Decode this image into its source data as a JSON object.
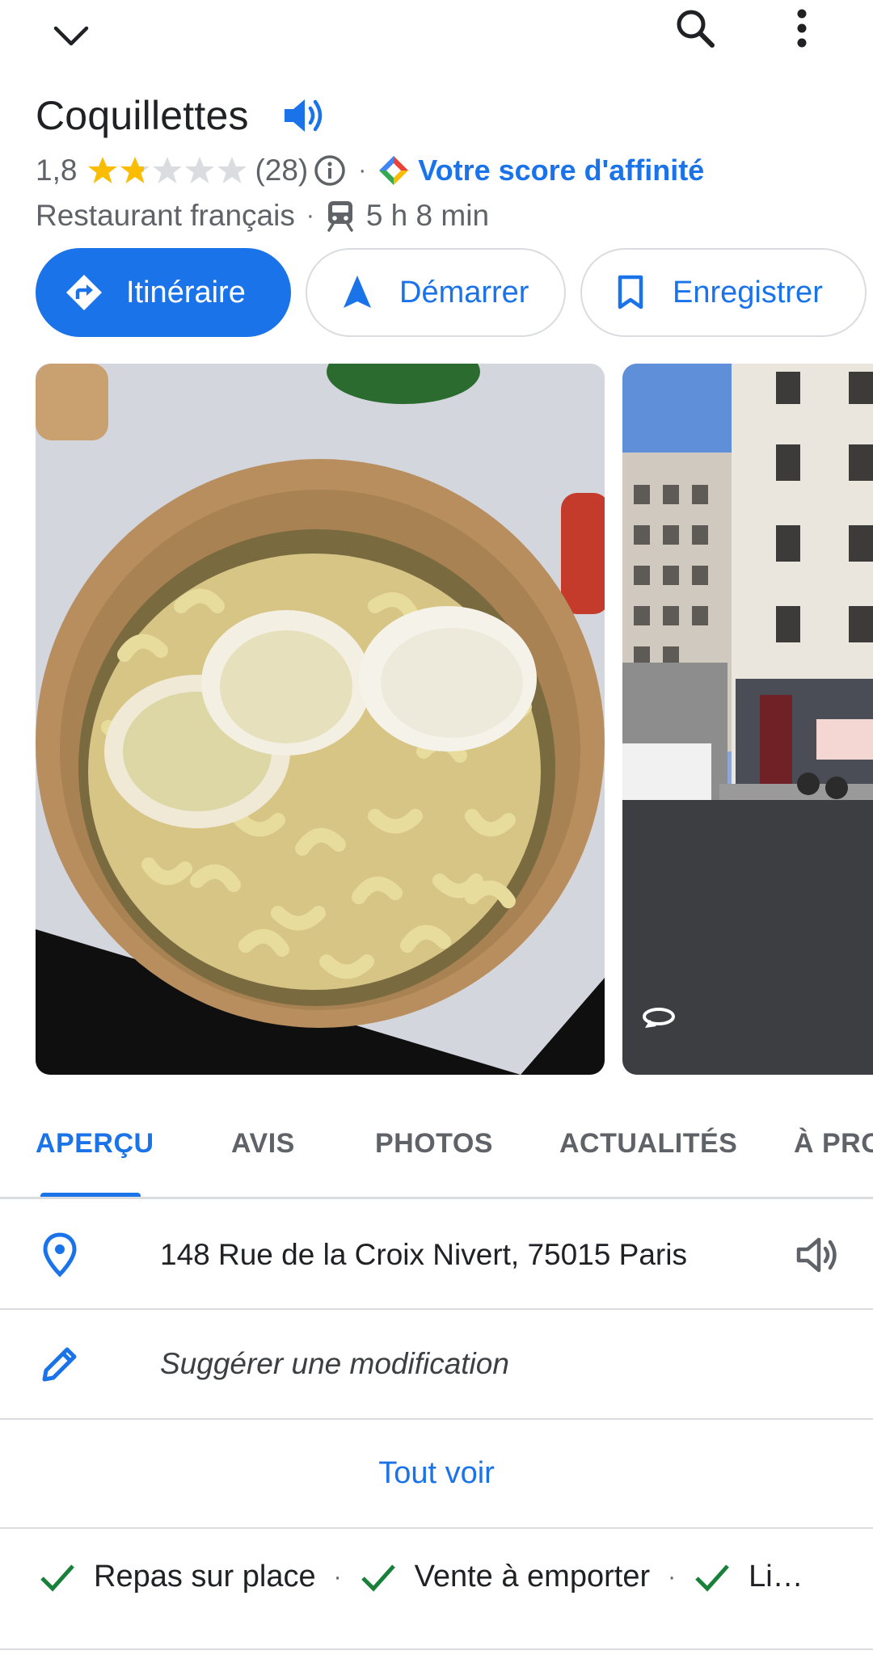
{
  "header": {
    "back_icon": "chevron-down-icon",
    "search_icon": "search-icon",
    "more_icon": "more-vert-icon"
  },
  "place": {
    "name": "Coquillettes",
    "rating": "1,8",
    "rating_value": 1.8,
    "rating_max": 5,
    "review_count": "(28)",
    "affinity_label": "Votre score d'affinité",
    "category": "Restaurant français",
    "transit_time": "5 h 8 min"
  },
  "actions": {
    "directions_label": "Itinéraire",
    "start_label": "Démarrer",
    "save_label": "Enregistrer"
  },
  "tabs": [
    {
      "label": "APERÇU",
      "active": true
    },
    {
      "label": "AVIS",
      "active": false
    },
    {
      "label": "PHOTOS",
      "active": false
    },
    {
      "label": "ACTUALITÉS",
      "active": false
    },
    {
      "label": "À PRO",
      "active": false
    }
  ],
  "details": {
    "address": "148 Rue de la Croix Nivert, 75015 Paris",
    "suggest_edit": "Suggérer une modification",
    "see_all": "Tout voir"
  },
  "amenities": [
    "Repas sur place",
    "Vente à emporter",
    "Li…"
  ],
  "colors": {
    "accent": "#1a73e8",
    "star": "#fbbc04",
    "star_empty": "#dadce0",
    "text": "#202124",
    "muted": "#5f6368",
    "check": "#188038"
  }
}
